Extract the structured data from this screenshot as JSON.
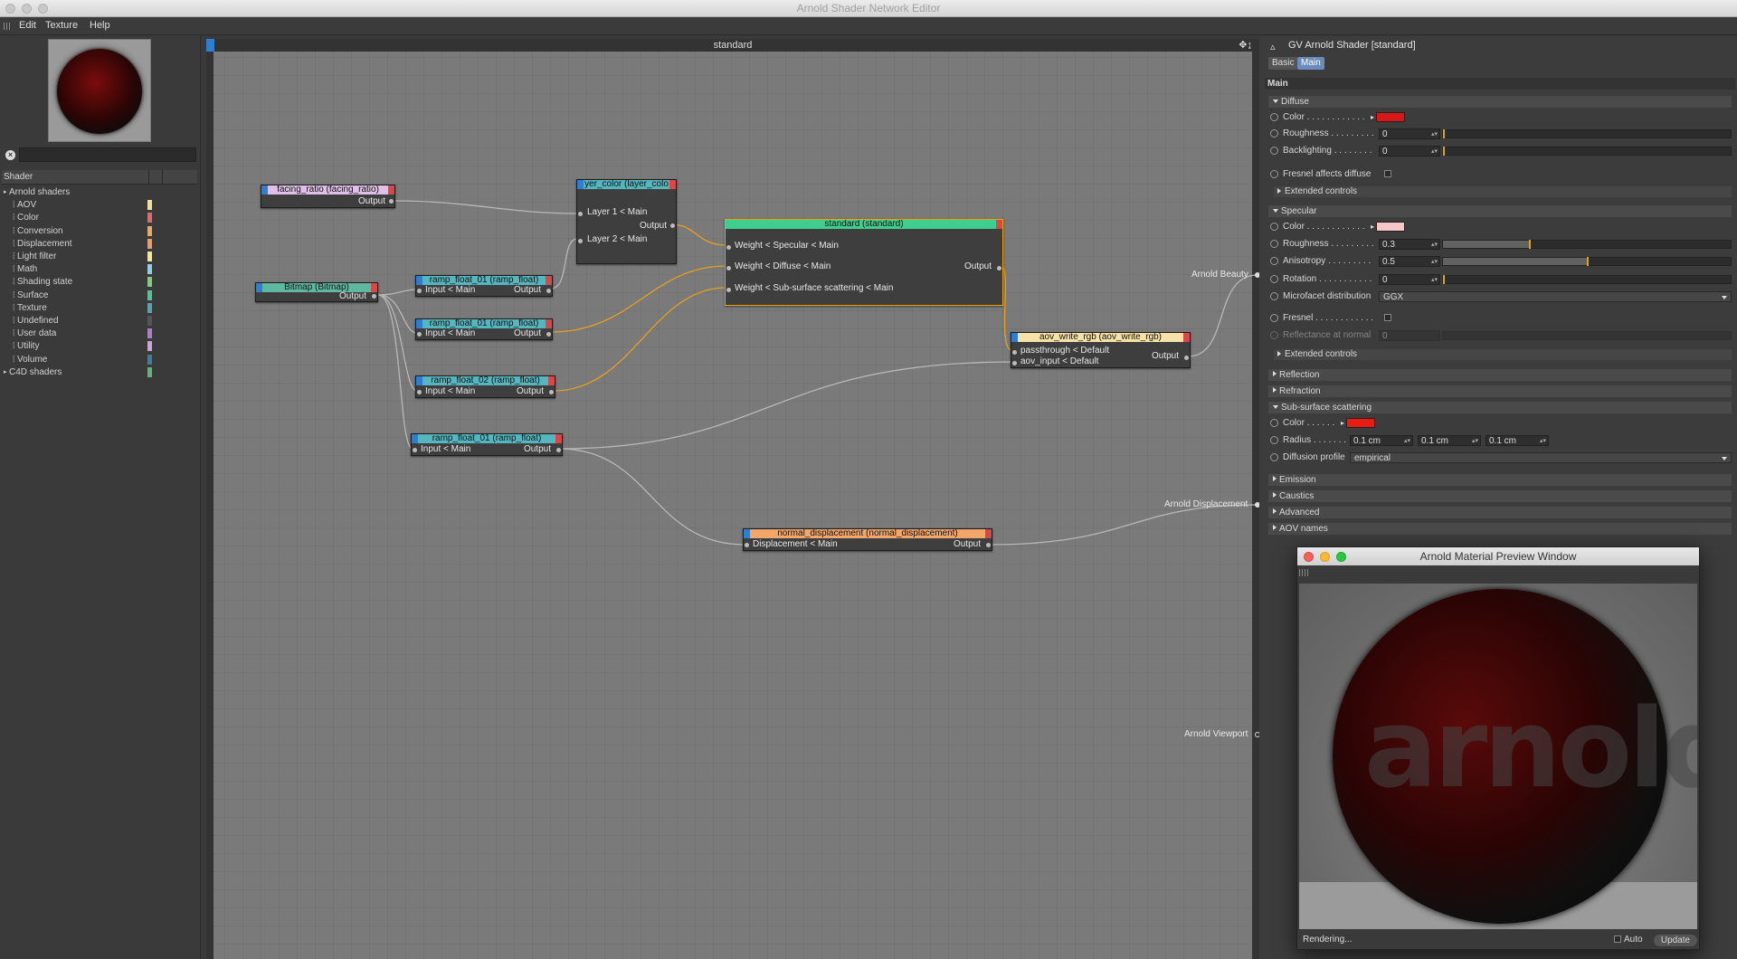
{
  "window": {
    "title": "Arnold Shader Network Editor"
  },
  "menu": {
    "items": [
      "Edit",
      "Texture",
      "Help"
    ]
  },
  "left": {
    "tree_header": "Shader",
    "items": [
      {
        "label": "Arnold shaders",
        "level": 0,
        "color": ""
      },
      {
        "label": "AOV",
        "level": 1,
        "color": "#f2e38a"
      },
      {
        "label": "Color",
        "level": 1,
        "color": "#e46a6a"
      },
      {
        "label": "Conversion",
        "level": 1,
        "color": "#f0a95a"
      },
      {
        "label": "Displacement",
        "level": 1,
        "color": "#f39a5c"
      },
      {
        "label": "Light filter",
        "level": 1,
        "color": "#f3ea8a"
      },
      {
        "label": "Math",
        "level": 1,
        "color": "#8ad0f0"
      },
      {
        "label": "Shading state",
        "level": 1,
        "color": "#7fce7a"
      },
      {
        "label": "Surface",
        "level": 1,
        "color": "#48c99a"
      },
      {
        "label": "Texture",
        "level": 1,
        "color": "#4fa7b4"
      },
      {
        "label": "Undefined",
        "level": 1,
        "color": "#555555"
      },
      {
        "label": "User data",
        "level": 1,
        "color": "#b07ad0"
      },
      {
        "label": "Utility",
        "level": 1,
        "color": "#d0a0e0"
      },
      {
        "label": "Volume",
        "level": 1,
        "color": "#3a7ea0"
      },
      {
        "label": "C4D shaders",
        "level": 0,
        "color": "#5cb87a"
      }
    ]
  },
  "canvas": {
    "title": "standard",
    "external": {
      "beauty": "Arnold Beauty",
      "displacement": "Arnold Displacement",
      "viewport": "Arnold Viewport"
    },
    "nodes": {
      "facing_ratio": {
        "title": "facing_ratio (facing_ratio)",
        "out": "Output",
        "color": "#e0c0e8"
      },
      "layer_color": {
        "title": "yer_color (layer_colo",
        "in1": "Layer 1 < Main",
        "in2": "Layer 2 < Main",
        "out": "Output",
        "color": "#54b7c0"
      },
      "standard": {
        "title": "standard (standard)",
        "in1": "Weight < Specular < Main",
        "in2": "Weight < Diffuse < Main",
        "in3": "Weight < Sub-surface scattering < Main",
        "out": "Output",
        "color": "#3ecf8e"
      },
      "bitmap": {
        "title": "Bitmap (Bitmap)",
        "out": "Output",
        "color": "#5fb8a0"
      },
      "ramp1": {
        "title": "ramp_float_01 (ramp_float)",
        "in": "Input < Main",
        "out": "Output",
        "color": "#54b7c0"
      },
      "ramp2": {
        "title": "ramp_float_01 (ramp_float)",
        "in": "Input < Main",
        "out": "Output",
        "color": "#54b7c0"
      },
      "ramp3": {
        "title": "ramp_float_02 (ramp_float)",
        "in": "Input < Main",
        "out": "Output",
        "color": "#54b7c0"
      },
      "ramp4": {
        "title": "ramp_float_01 (ramp_float)",
        "in": "Input < Main",
        "out": "Output",
        "color": "#54b7c0"
      },
      "aov": {
        "title": "aov_write_rgb (aov_write_rgb)",
        "in1": "passthrough < Default",
        "in2": "aov_input < Default",
        "out": "Output",
        "color": "#f6e2a6"
      },
      "normal_disp": {
        "title": "normal_displacement (normal_displacement)",
        "in": "Displacement < Main",
        "out": "Output",
        "color": "#f2a66a"
      }
    }
  },
  "attrs": {
    "title": "GV Arnold Shader [standard]",
    "tabs": [
      "Basic",
      "Main"
    ],
    "active_tab": "Main",
    "group": "Main",
    "diffuse": {
      "header": "Diffuse",
      "color_label": "Color . . . . . . . . . . . .",
      "color": "#d61818",
      "roughness_label": "Roughness . . . . . . . . .",
      "roughness": "0",
      "backlighting_label": "Backlighting . . . . . . . .",
      "backlighting": "0",
      "fresnel_label": "Fresnel affects diffuse",
      "extended": "Extended controls"
    },
    "specular": {
      "header": "Specular",
      "color_label": "Color . . . . . . . . . . . .",
      "color": "#f6c6c6",
      "roughness_label": "Roughness . . . . . . . . .",
      "roughness": "0.3",
      "roughness_level": 0.3,
      "anisotropy_label": "Anisotropy . . . . . . . . .",
      "anisotropy": "0.5",
      "anisotropy_level": 0.5,
      "rotation_label": "Rotation . . . . . . . . . . .",
      "rotation": "0",
      "microfacet_label": "Microfacet distribution",
      "microfacet": "GGX",
      "fresnel_label": "Fresnel . . . . . . . . . . . .",
      "reflectance_label": "Reflectance at normal",
      "reflectance": "0",
      "extended": "Extended controls"
    },
    "collapsed1": [
      "Reflection",
      "Refraction"
    ],
    "sss": {
      "header": "Sub-surface scattering",
      "color_label": "Color . . . . . .",
      "color": "#e81c10",
      "radius_label": "Radius . . . . . . .",
      "radius": [
        "0.1 cm",
        "0.1 cm",
        "0.1 cm"
      ],
      "profile_label": "Diffusion profile",
      "profile": "empirical"
    },
    "collapsed2": [
      "Emission",
      "Caustics",
      "Advanced",
      "AOV names"
    ]
  },
  "preview": {
    "title": "Arnold Material Preview Window",
    "word": "arnold",
    "status": "Rendering...",
    "auto_label": "Auto",
    "update_label": "Update"
  }
}
